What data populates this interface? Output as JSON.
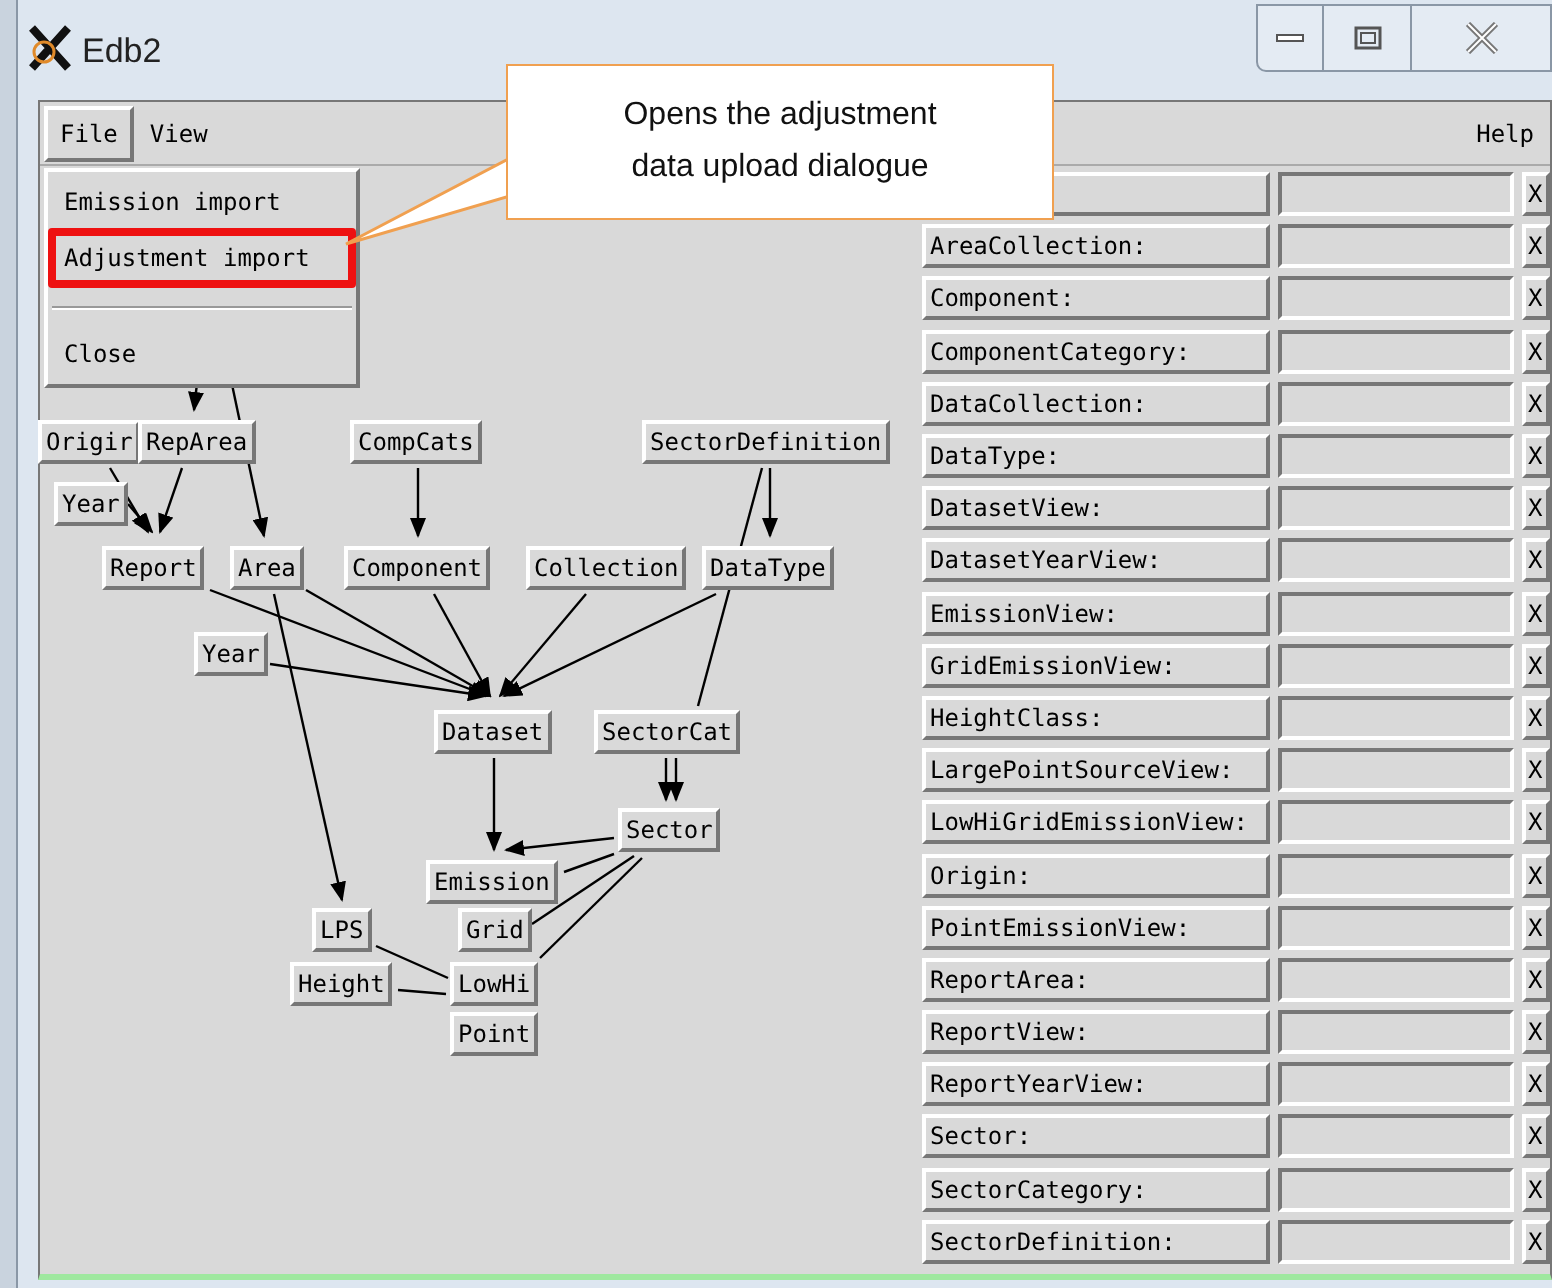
{
  "window": {
    "title": "Edb2"
  },
  "menu_bar": {
    "items": [
      {
        "label": "File",
        "selected": true
      },
      {
        "label": "View",
        "selected": false
      }
    ],
    "help": "Help"
  },
  "file_menu": {
    "items": [
      {
        "kind": "item",
        "label": "Emission import",
        "highlighted": false
      },
      {
        "kind": "item",
        "label": "Adjustment import",
        "highlighted": true
      },
      {
        "kind": "separator"
      },
      {
        "kind": "item",
        "label": "Close",
        "highlighted": false
      }
    ]
  },
  "callout": {
    "text": "Opens the adjustment data upload dialogue"
  },
  "diagram": {
    "nodes": [
      {
        "label": "Origir"
      },
      {
        "label": "RepArea"
      },
      {
        "label": "CompCats"
      },
      {
        "label": "SectorDefinition"
      },
      {
        "label": "Year"
      },
      {
        "label": "Report"
      },
      {
        "label": "Area"
      },
      {
        "label": "Component"
      },
      {
        "label": "Collection"
      },
      {
        "label": "DataType"
      },
      {
        "label": "Year"
      },
      {
        "label": "Dataset"
      },
      {
        "label": "SectorCat"
      },
      {
        "label": "Sector"
      },
      {
        "label": "Emission"
      },
      {
        "label": "LPS"
      },
      {
        "label": "Grid"
      },
      {
        "label": "Height"
      },
      {
        "label": "LowHi"
      },
      {
        "label": "Point"
      }
    ]
  },
  "table_panel": {
    "rows": [
      {
        "clear": "X"
      },
      {
        "label": "AreaCollection:",
        "clear": "X"
      },
      {
        "label": "Component:",
        "clear": "X"
      },
      {
        "label": "ComponentCategory:",
        "clear": "X"
      },
      {
        "label": "DataCollection:",
        "clear": "X"
      },
      {
        "label": "DataType:",
        "clear": "X"
      },
      {
        "label": "DatasetView:",
        "clear": "X"
      },
      {
        "label": "DatasetYearView:",
        "clear": "X"
      },
      {
        "label": "EmissionView:",
        "clear": "X"
      },
      {
        "label": "GridEmissionView:",
        "clear": "X"
      },
      {
        "label": "HeightClass:",
        "clear": "X"
      },
      {
        "label": "LargePointSourceView:",
        "clear": "X"
      },
      {
        "label": "LowHiGridEmissionView:",
        "clear": "X"
      },
      {
        "label": "Origin:",
        "clear": "X"
      },
      {
        "label": "PointEmissionView:",
        "clear": "X"
      },
      {
        "label": "ReportArea:",
        "clear": "X"
      },
      {
        "label": "ReportView:",
        "clear": "X"
      },
      {
        "label": "ReportYearView:",
        "clear": "X"
      },
      {
        "label": "Sector:",
        "clear": "X"
      },
      {
        "label": "SectorCategory:",
        "clear": "X"
      },
      {
        "label": "SectorDefinition:",
        "clear": "X"
      }
    ]
  }
}
